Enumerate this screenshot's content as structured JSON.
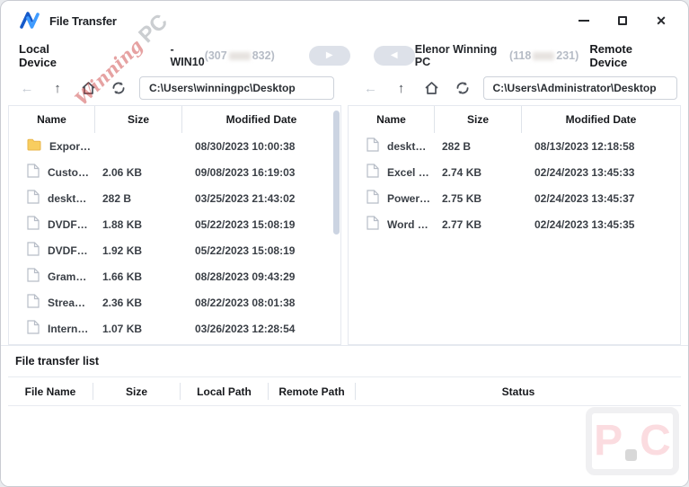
{
  "window": {
    "title": "File Transfer",
    "close_glyph": "✕"
  },
  "device_bar": {
    "local_label": "Local Device",
    "local_device_name": "-WIN10",
    "local_device_id_prefix": "(307",
    "local_device_id_suffix": "832)",
    "transfer_right_glyph": "▶",
    "transfer_left_glyph": "◀",
    "remote_device_name": "Elenor Winning PC",
    "remote_device_id_prefix": "(118",
    "remote_device_id_suffix": "231)",
    "remote_label": "Remote Device"
  },
  "icons": {
    "back": "←",
    "up": "↑"
  },
  "left_panel": {
    "path": "C:\\Users\\winningpc\\Desktop",
    "columns": [
      "Name",
      "Size",
      "Modified Date"
    ],
    "rows": [
      {
        "type": "folder",
        "name": "Expor…",
        "size": "",
        "modified": "08/30/2023 10:00:38"
      },
      {
        "type": "file",
        "name": "Custo…",
        "size": "2.06 KB",
        "modified": "09/08/2023 16:19:03"
      },
      {
        "type": "file",
        "name": "deskt…",
        "size": "282 B",
        "modified": "03/25/2023 21:43:02"
      },
      {
        "type": "file",
        "name": "DVDF…",
        "size": "1.88 KB",
        "modified": "05/22/2023 15:08:19"
      },
      {
        "type": "file",
        "name": "DVDF…",
        "size": "1.92 KB",
        "modified": "05/22/2023 15:08:19"
      },
      {
        "type": "file",
        "name": "Gram…",
        "size": "1.66 KB",
        "modified": "08/28/2023 09:43:29"
      },
      {
        "type": "file",
        "name": "Strea…",
        "size": "2.36 KB",
        "modified": "08/22/2023 08:01:38"
      },
      {
        "type": "file",
        "name": "Intern…",
        "size": "1.07 KB",
        "modified": "03/26/2023 12:28:54"
      }
    ]
  },
  "right_panel": {
    "path": "C:\\Users\\Administrator\\Desktop",
    "columns": [
      "Name",
      "Size",
      "Modified Date"
    ],
    "rows": [
      {
        "type": "file",
        "name": "deskt…",
        "size": "282 B",
        "modified": "08/13/2023 12:18:58"
      },
      {
        "type": "file",
        "name": "Excel …",
        "size": "2.74 KB",
        "modified": "02/24/2023 13:45:33"
      },
      {
        "type": "file",
        "name": "Power…",
        "size": "2.75 KB",
        "modified": "02/24/2023 13:45:37"
      },
      {
        "type": "file",
        "name": "Word …",
        "size": "2.77 KB",
        "modified": "02/24/2023 13:45:35"
      }
    ]
  },
  "transfer_section": {
    "title": "File transfer list",
    "columns": [
      "File Name",
      "Size",
      "Local Path",
      "Remote Path",
      "Status"
    ],
    "rows": []
  },
  "watermarks": {
    "diagonal_word1": "Winning",
    "diagonal_word2": "PC",
    "corner_letter1": "P",
    "corner_letter2": "C"
  },
  "colors": {
    "accent_blue": "#2f7df6",
    "logo_dark_blue": "#1559c9",
    "folder_yellow": "#f8cd5f",
    "disabled_button_gray": "#dde1e9",
    "muted_text": "#b6bcc6"
  }
}
